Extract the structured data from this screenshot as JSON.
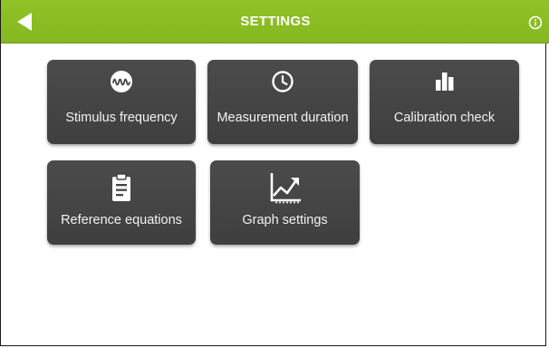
{
  "header": {
    "title": "SETTINGS",
    "back_icon": "back-arrow-icon",
    "info_icon": "info-icon",
    "accent_color": "#8bbf23"
  },
  "tiles": [
    {
      "label": "Stimulus frequency",
      "icon": "waveform-icon"
    },
    {
      "label": "Measurement duration",
      "icon": "clock-icon"
    },
    {
      "label": "Calibration check",
      "icon": "bar-chart-icon"
    },
    {
      "label": "Reference equations",
      "icon": "clipboard-icon"
    },
    {
      "label": "Graph settings",
      "icon": "trend-chart-icon"
    }
  ]
}
